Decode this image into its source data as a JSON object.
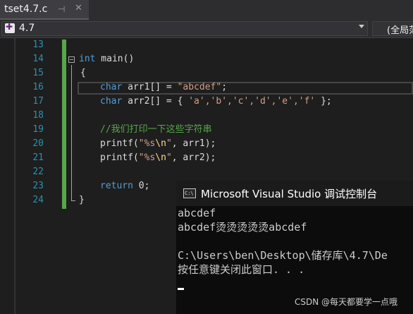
{
  "tab": {
    "title": "tset4.7.c",
    "pin": "⊣",
    "close": "✕"
  },
  "nav": {
    "project": "4.7",
    "scope": "(全局范围)"
  },
  "gutter": {
    "lines": [
      "13",
      "14",
      "15",
      "16",
      "17",
      "18",
      "19",
      "20",
      "21",
      "22",
      "23",
      "24"
    ]
  },
  "code": {
    "l14_kw": "int",
    "l14_rest": " main()",
    "l15": "{",
    "l16_kw": "char",
    "l16_mid": " arr1[] = ",
    "l16_str": "\"abcdef\"",
    "l16_end": ";",
    "l17_kw": "char",
    "l17_mid": " arr2[] = { ",
    "l17_chars": "'a','b','c','d','e','f'",
    "l17_end": " };",
    "l19_comment": "//我们打印一下这些字符串",
    "l20_fn": "printf(",
    "l20_str1": "\"%s",
    "l20_esc": "\\n",
    "l20_str2": "\"",
    "l20_end": ", arr1);",
    "l21_fn": "printf(",
    "l21_str1": "\"%s",
    "l21_esc": "\\n",
    "l21_str2": "\"",
    "l21_end": ", arr2);",
    "l23_kw": "return",
    "l23_end": " 0;",
    "l24": "}"
  },
  "console": {
    "icon": "C:\\",
    "title": "Microsoft Visual Studio 调试控制台",
    "lines": [
      "abcdef",
      "abcdef烫烫烫烫烫abcdef",
      "",
      "C:\\Users\\ben\\Desktop\\储存库\\4.7\\De",
      "按任意键关闭此窗口. . ."
    ]
  },
  "watermark": "CSDN @每天都要学一点哦"
}
